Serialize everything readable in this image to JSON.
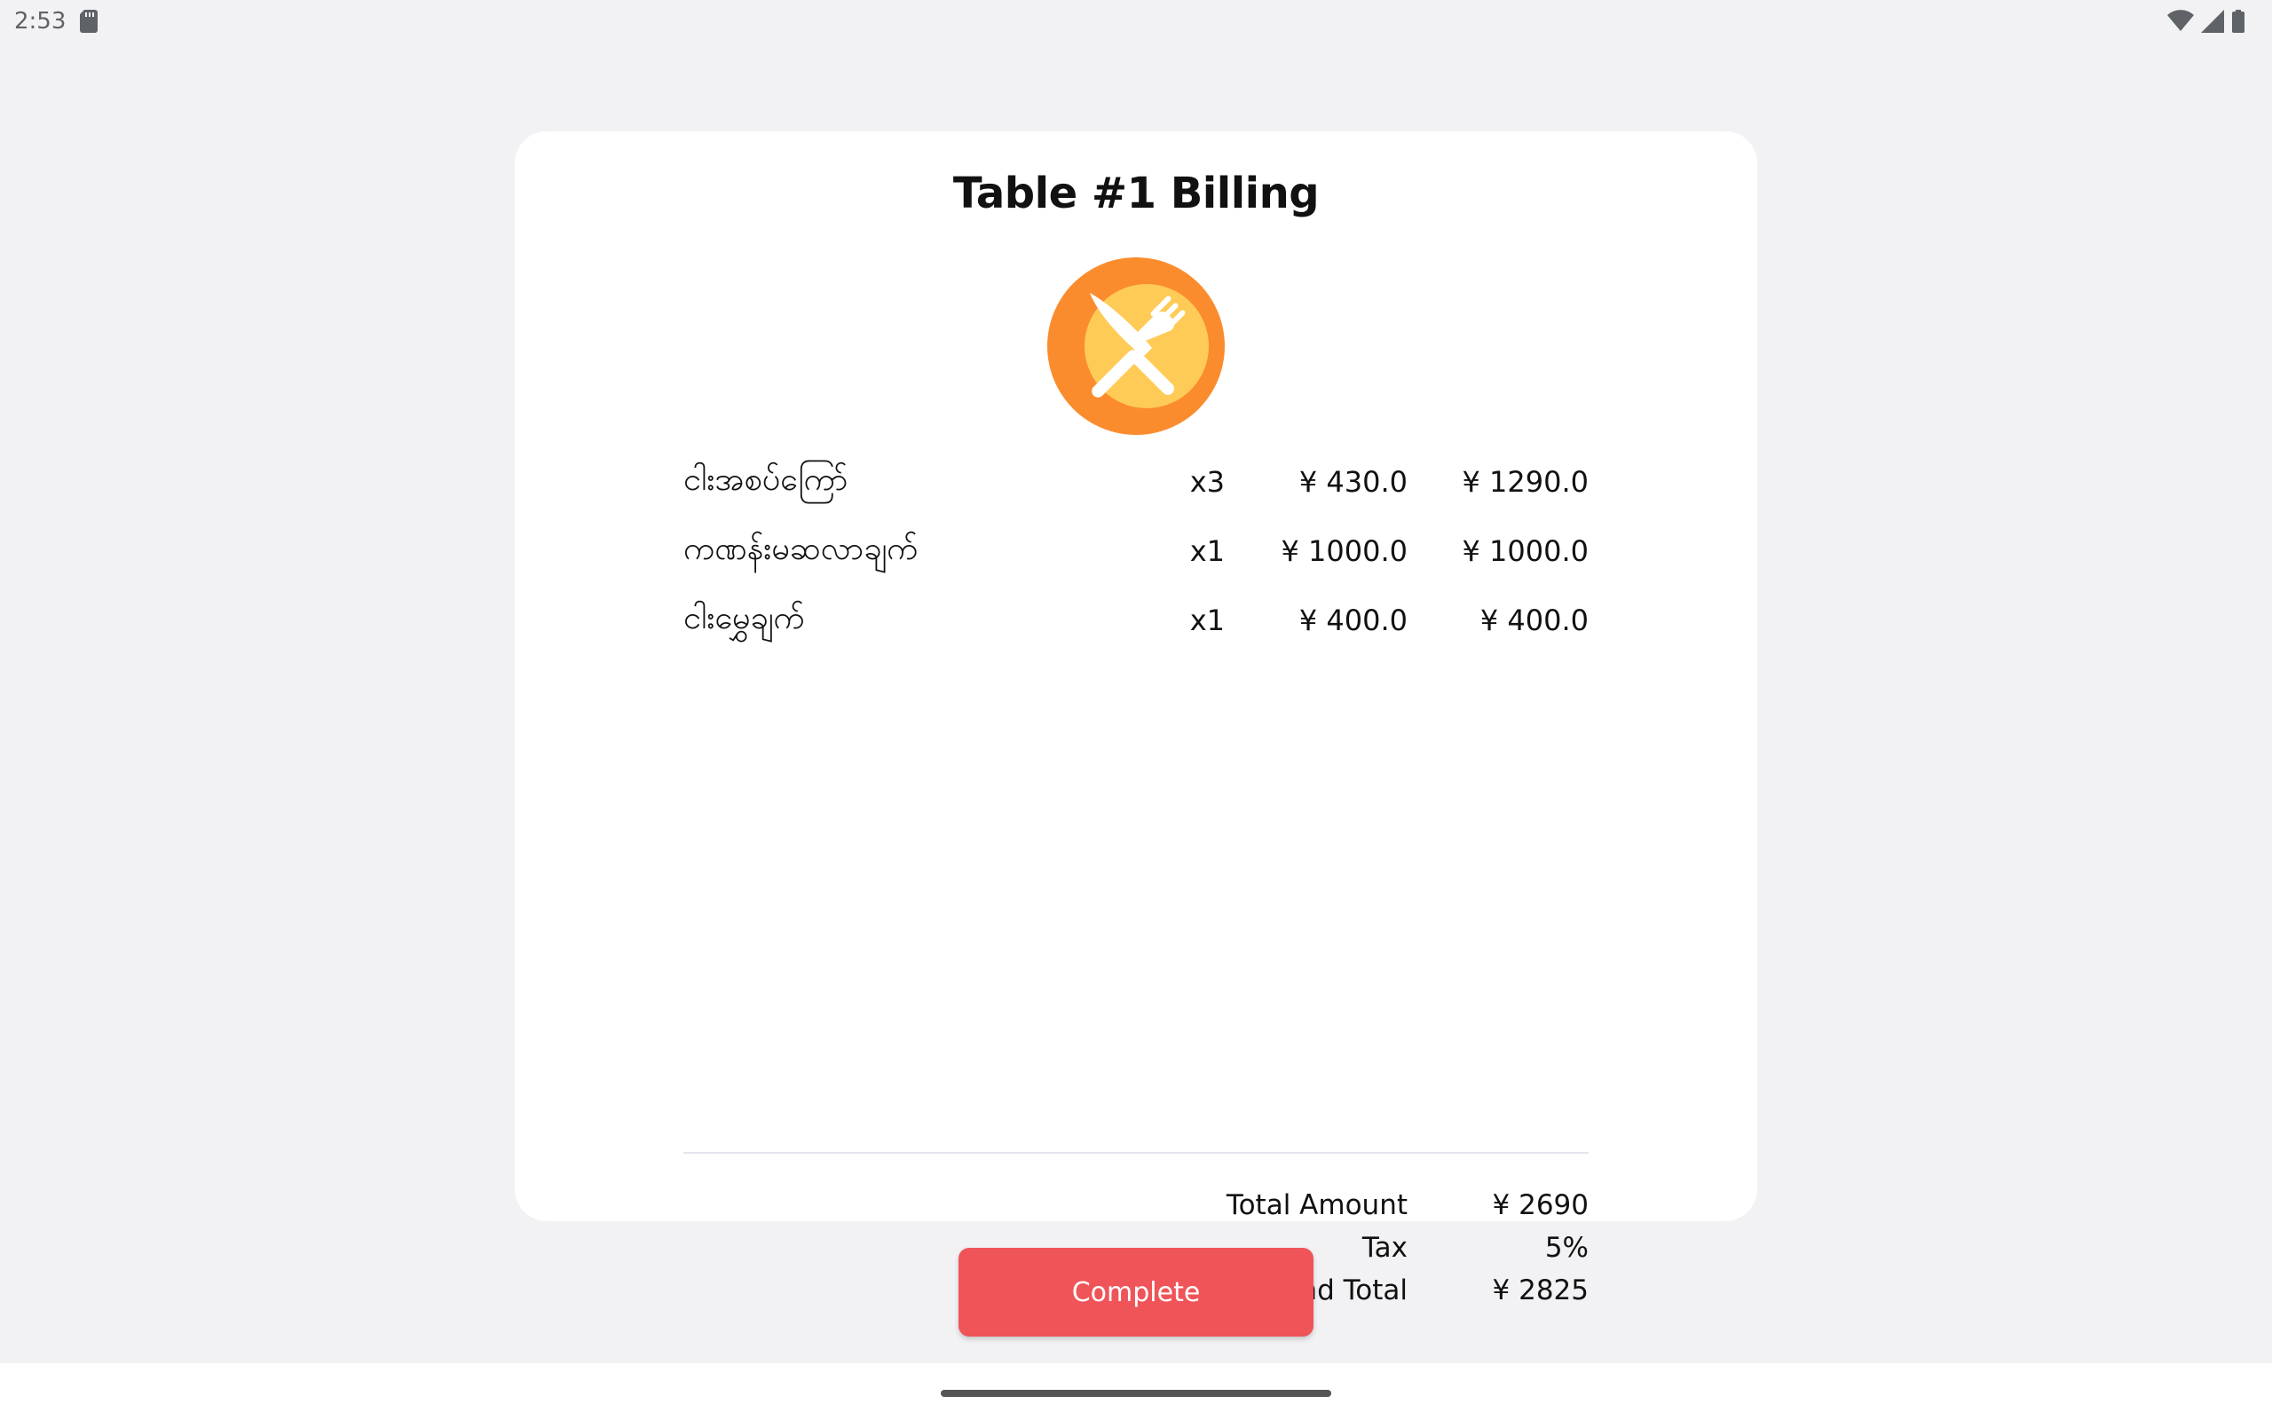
{
  "status_bar": {
    "time": "2:53",
    "icons": [
      "sd-card-icon",
      "wifi-icon",
      "cell-signal-icon",
      "battery-icon"
    ]
  },
  "bill": {
    "title": "Table #1 Billing",
    "logo_icon": "restaurant-fork-knife-icon",
    "items": [
      {
        "name": "ငါးအစပ်ကြော်",
        "qty": "x3",
        "price": "¥ 430.0",
        "total": "¥ 1290.0"
      },
      {
        "name": "ကဏန်းမဆလာချက်",
        "qty": "x1",
        "price": "¥ 1000.0",
        "total": "¥ 1000.0"
      },
      {
        "name": "ငါးမွှေချက်",
        "qty": "x1",
        "price": "¥ 400.0",
        "total": "¥ 400.0"
      }
    ],
    "summary": {
      "total_amount_label": "Total Amount",
      "total_amount_value": "¥ 2690",
      "tax_label": "Tax",
      "tax_value": "5%",
      "grand_total_label": "Grand Total",
      "grand_total_value": "¥ 2825"
    }
  },
  "actions": {
    "complete_label": "Complete"
  },
  "colors": {
    "background": "#f2f2f4",
    "card": "#ffffff",
    "complete_button": "#ef5459",
    "logo_outer": "#fb8c2e",
    "logo_inner": "#ffcb57"
  }
}
